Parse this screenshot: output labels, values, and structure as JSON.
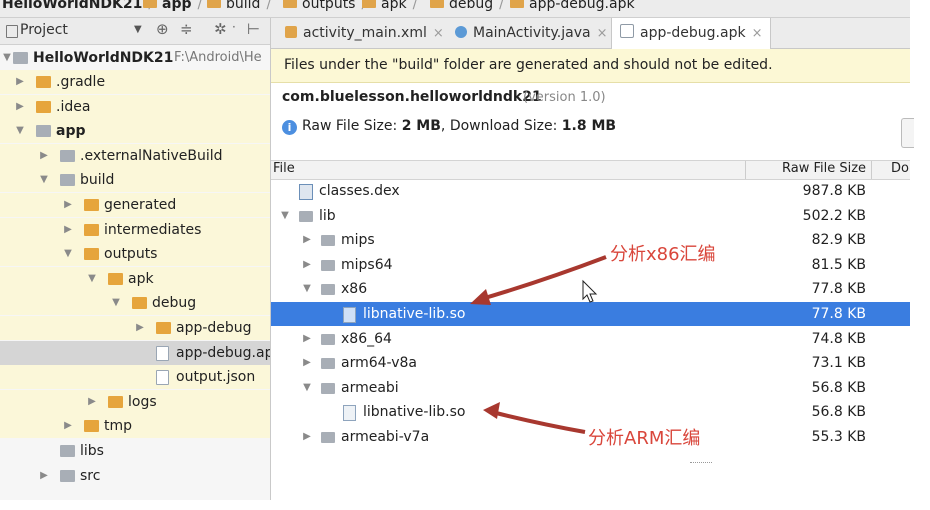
{
  "breadcrumb": [
    "HelloWorldNDK21",
    "app",
    "build",
    "outputs",
    "apk",
    "debug",
    "app-debug.apk"
  ],
  "project_panel": {
    "title": "Project",
    "root": {
      "name": "HelloWorldNDK21",
      "path": "F:\\Android\\He"
    },
    "tree": [
      {
        "label": ".gradle",
        "depth": 1,
        "expanded": false,
        "icon": "folder"
      },
      {
        "label": ".idea",
        "depth": 1,
        "expanded": false,
        "icon": "folder"
      },
      {
        "label": "app",
        "depth": 1,
        "expanded": true,
        "icon": "module-folder"
      },
      {
        "label": ".externalNativeBuild",
        "depth": 2,
        "expanded": false,
        "icon": "folder"
      },
      {
        "label": "build",
        "depth": 2,
        "expanded": true,
        "icon": "folder"
      },
      {
        "label": "generated",
        "depth": 3,
        "expanded": false,
        "icon": "folder"
      },
      {
        "label": "intermediates",
        "depth": 3,
        "expanded": false,
        "icon": "folder"
      },
      {
        "label": "outputs",
        "depth": 3,
        "expanded": true,
        "icon": "folder"
      },
      {
        "label": "apk",
        "depth": 4,
        "expanded": true,
        "icon": "folder"
      },
      {
        "label": "debug",
        "depth": 5,
        "expanded": true,
        "icon": "folder"
      },
      {
        "label": "app-debug",
        "depth": 6,
        "expanded": false,
        "icon": "folder"
      },
      {
        "label": "app-debug.ap",
        "depth": 6,
        "expanded": null,
        "icon": "apk-file"
      },
      {
        "label": "output.json",
        "depth": 6,
        "expanded": null,
        "icon": "json-file"
      },
      {
        "label": "logs",
        "depth": 4,
        "expanded": false,
        "icon": "folder"
      },
      {
        "label": "tmp",
        "depth": 3,
        "expanded": false,
        "icon": "folder"
      },
      {
        "label": "libs",
        "depth": 2,
        "expanded": null,
        "icon": "folder"
      },
      {
        "label": "src",
        "depth": 2,
        "expanded": false,
        "icon": "folder"
      }
    ]
  },
  "tabs": [
    {
      "label": "activity_main.xml",
      "icon": "xml-file-icon",
      "active": false
    },
    {
      "label": "MainActivity.java",
      "icon": "java-class-icon",
      "active": false
    },
    {
      "label": "app-debug.apk",
      "icon": "apk-file-icon",
      "active": true
    }
  ],
  "tab_close": "×",
  "notice": "Files under the \"build\" folder are generated and should not be edited.",
  "apk": {
    "package": "com.bluelesson.helloworldndk21",
    "version": "(version 1.0)",
    "raw_label": "Raw File Size:",
    "raw_value": "2 MB",
    "sep": ",",
    "download_label": "Download Size:",
    "download_value": "1.8 MB"
  },
  "table": {
    "headers": {
      "file": "File",
      "raw": "Raw File Size",
      "download": "Do"
    },
    "rows": [
      {
        "name": "classes.dex",
        "size": "987.8 KB",
        "depth": 0,
        "arrow": "",
        "icon": "dex"
      },
      {
        "name": "lib",
        "size": "502.2 KB",
        "depth": 0,
        "arrow": "open",
        "icon": "folder"
      },
      {
        "name": "mips",
        "size": "82.9 KB",
        "depth": 1,
        "arrow": "closed",
        "icon": "folder"
      },
      {
        "name": "mips64",
        "size": "81.5 KB",
        "depth": 1,
        "arrow": "closed",
        "icon": "folder"
      },
      {
        "name": "x86",
        "size": "77.8 KB",
        "depth": 1,
        "arrow": "open",
        "icon": "folder"
      },
      {
        "name": "libnative-lib.so",
        "size": "77.8 KB",
        "depth": 2,
        "arrow": "",
        "icon": "so-file",
        "selected": true
      },
      {
        "name": "x86_64",
        "size": "74.8 KB",
        "depth": 1,
        "arrow": "closed",
        "icon": "folder"
      },
      {
        "name": "arm64-v8a",
        "size": "73.1 KB",
        "depth": 1,
        "arrow": "closed",
        "icon": "folder"
      },
      {
        "name": "armeabi",
        "size": "56.8 KB",
        "depth": 1,
        "arrow": "open",
        "icon": "folder"
      },
      {
        "name": "libnative-lib.so",
        "size": "56.8 KB",
        "depth": 2,
        "arrow": "",
        "icon": "so-file"
      },
      {
        "name": "armeabi-v7a",
        "size": "55.3 KB",
        "depth": 1,
        "arrow": "closed",
        "icon": "folder"
      }
    ]
  },
  "annotations": {
    "x86": "分析x86汇编",
    "arm": "分析ARM汇编",
    "color": "#d9463b"
  },
  "colors": {
    "selection": "#3a7de0",
    "notice_bg": "#fcf8d5",
    "folder": "#e6a53c"
  }
}
